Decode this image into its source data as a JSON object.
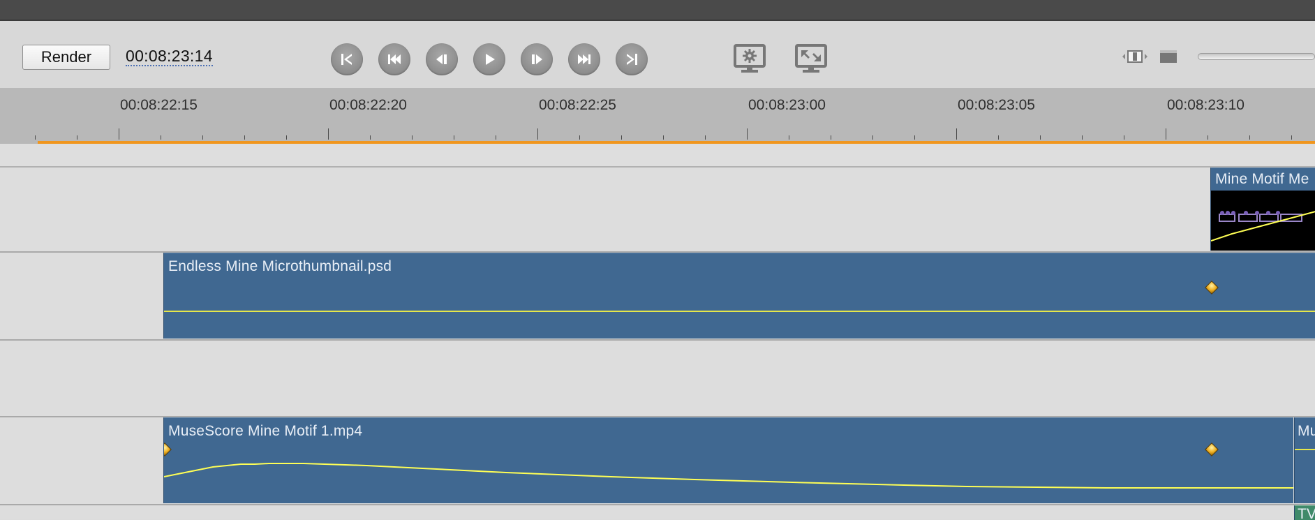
{
  "toolbar": {
    "render_label": "Render",
    "timecode": "00:08:23:14"
  },
  "transport": [
    {
      "name": "go-to-start"
    },
    {
      "name": "previous-keyframe"
    },
    {
      "name": "step-back"
    },
    {
      "name": "play"
    },
    {
      "name": "step-forward"
    },
    {
      "name": "next-keyframe"
    },
    {
      "name": "go-to-end"
    }
  ],
  "ruler": {
    "labels": [
      "00:08:22:15",
      "00:08:22:20",
      "00:08:22:25",
      "00:08:23:00",
      "00:08:23:05",
      "00:08:23:10"
    ]
  },
  "tracks": {
    "track1": {
      "clip_title": "Mine Motif Me"
    },
    "track2": {
      "clip_title": "Endless Mine Microthumbnail.psd"
    },
    "track4": {
      "clip_title": "MuseScore Mine Motif 1.mp4",
      "next_clip_title": "Mu"
    },
    "track5": {
      "clip_title": "TV"
    }
  },
  "colors": {
    "clip_blue": "#406891",
    "playhead_range": "#f0961e",
    "envelope": "#ffff55",
    "keyframe": "#f0b224"
  }
}
